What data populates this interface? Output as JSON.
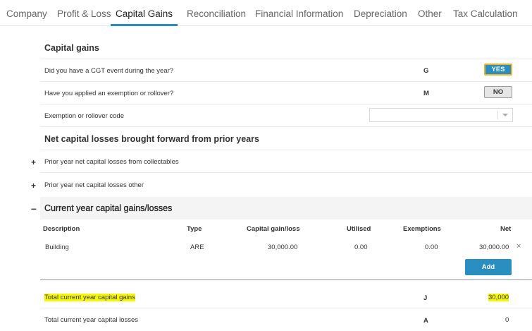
{
  "tabs": [
    {
      "label": "Company"
    },
    {
      "label": "Profit & Loss"
    },
    {
      "label": "Capital Gains"
    },
    {
      "label": "Reconciliation"
    },
    {
      "label": "Financial Information"
    },
    {
      "label": "Depreciation"
    },
    {
      "label": "Other"
    },
    {
      "label": "Tax Calculation"
    }
  ],
  "active_tab": "Capital Gains",
  "capital_gains": {
    "title": "Capital gains",
    "cgt_event": {
      "label": "Did you have a CGT event during the year?",
      "code": "G",
      "value": "YES"
    },
    "exemption": {
      "label": "Have you applied an exemption or rollover?",
      "code": "M",
      "value": "NO"
    },
    "exemption_code": {
      "label": "Exemption or rollover code",
      "value": ""
    }
  },
  "net_losses": {
    "title": "Net capital losses brought forward from prior years",
    "collectables": {
      "expander": "+",
      "label": "Prior year net capital losses from collectables"
    },
    "other": {
      "expander": "+",
      "label": "Prior year net capital losses other"
    }
  },
  "current_year": {
    "expander": "–",
    "title": "Current year capital gains/losses",
    "columns": [
      "Description",
      "Type",
      "Capital gain/loss",
      "Utilised",
      "Exemptions",
      "Net"
    ],
    "rows": [
      {
        "description": "Building",
        "type": "ARE",
        "gain_loss": "30,000.00",
        "utilised": "0.00",
        "exemptions": "0.00",
        "net": "30,000.00"
      }
    ],
    "remove_label": "×",
    "add_label": "Add"
  },
  "totals": {
    "gains": {
      "label": "Total current year capital gains",
      "code": "J",
      "value": "30,000"
    },
    "losses": {
      "label": "Total current year capital losses",
      "code": "A",
      "value": "0"
    }
  },
  "colors": {
    "accent": "#2a8fc0",
    "highlight": "#f7f700",
    "toggle_focus": "#f0b429"
  }
}
